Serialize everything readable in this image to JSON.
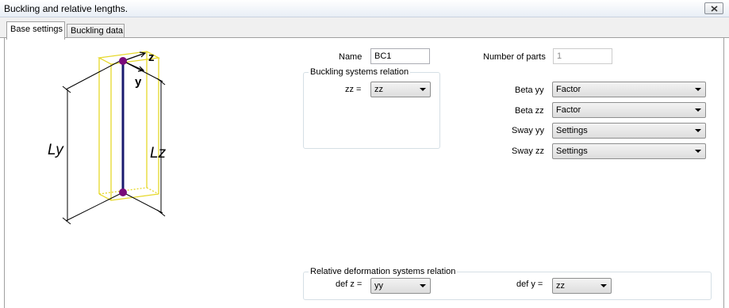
{
  "window": {
    "title": "Buckling and relative lengths.",
    "close_icon": "close-icon"
  },
  "tabs": [
    {
      "label": "Base settings",
      "active": true
    },
    {
      "label": "Buckling data",
      "active": false
    }
  ],
  "diagram": {
    "axis_z": "z",
    "axis_y": "y",
    "length_y": "Ly",
    "length_z": "Lz",
    "outline_color": "#e6d82a",
    "member_color": "#1a1a6e",
    "node_color": "#7a0a7a"
  },
  "form": {
    "name_label": "Name",
    "name_value": "BC1",
    "parts_label": "Number of parts",
    "parts_value": "1",
    "buckling_group_title": "Buckling systems relation",
    "zz_label": "zz =",
    "zz_value": "zz",
    "beta_yy_label": "Beta yy",
    "beta_yy_value": "Factor",
    "beta_zz_label": "Beta zz",
    "beta_zz_value": "Factor",
    "sway_yy_label": "Sway yy",
    "sway_yy_value": "Settings",
    "sway_zz_label": "Sway zz",
    "sway_zz_value": "Settings",
    "deform_group_title": "Relative deformation systems relation",
    "def_z_label": "def z =",
    "def_z_value": "yy",
    "def_y_label": "def y =",
    "def_y_value": "zz"
  }
}
